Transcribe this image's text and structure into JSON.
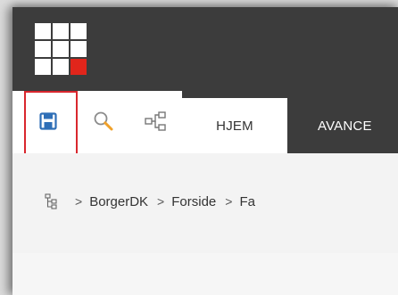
{
  "colors": {
    "topbar": "#3c3c3c",
    "accent_red": "#e1251b",
    "highlight": "#d9272e",
    "save_icon": "#2f6fb7"
  },
  "header": {
    "apps_icon": "grid-icon"
  },
  "toolbar": {
    "save_icon": "save-icon",
    "search_icon": "search-icon",
    "share_icon": "tree-share-icon",
    "tabs": [
      {
        "label": "HJEM",
        "active": true
      },
      {
        "label": "AVANCE",
        "active": false
      }
    ]
  },
  "breadcrumb": {
    "root_icon": "tree-icon",
    "separator": ">",
    "items": [
      {
        "label": "BorgerDK"
      },
      {
        "label": "Forside"
      },
      {
        "label": "Fa"
      }
    ]
  }
}
